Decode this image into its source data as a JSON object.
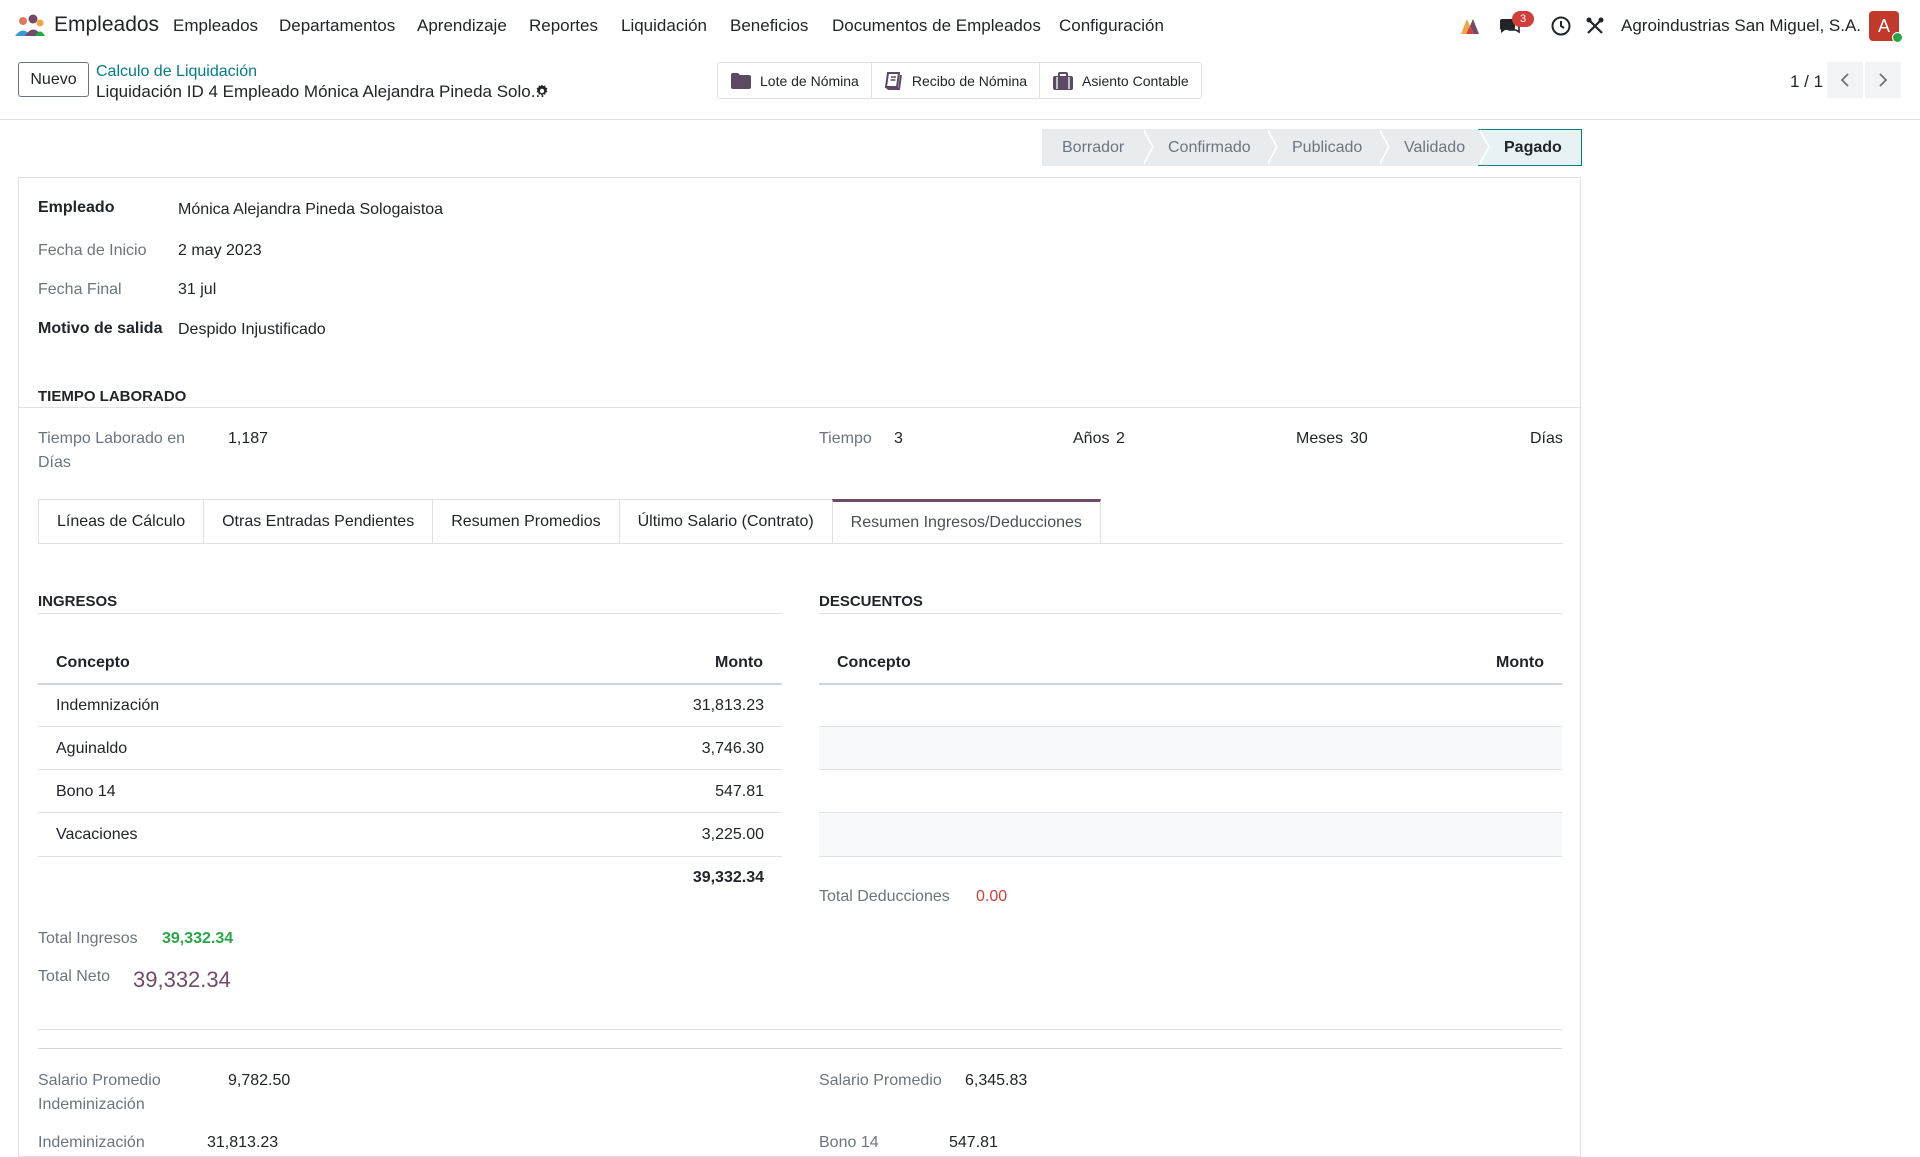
{
  "app": {
    "name": "Empleados",
    "menu": [
      "Empleados",
      "Departamentos",
      "Aprendizaje",
      "Reportes",
      "Liquidación",
      "Beneficios",
      "Documentos de Empleados",
      "Configuración"
    ],
    "notification_count": "3",
    "company": "Agroindustrias San Miguel, S.A.",
    "avatar_initial": "A"
  },
  "control_panel": {
    "new_button": "Nuevo",
    "breadcrumb_parent": "Calculo de Liquidación",
    "breadcrumb_current": "Liquidación ID 4 Empleado Mónica Alejandra Pineda Solo...",
    "smart_buttons": [
      "Lote de Nómina",
      "Recibo de Nómina",
      "Asiento Contable"
    ],
    "pager": "1 / 1"
  },
  "statusbar": [
    "Borrador",
    "Confirmado",
    "Publicado",
    "Validado",
    "Pagado"
  ],
  "statusbar_active": "Pagado",
  "header_fields": {
    "empleado_label": "Empleado",
    "empleado_value": "Mónica Alejandra Pineda Sologaistoa",
    "fecha_inicio_label": "Fecha de Inicio",
    "fecha_inicio_value": "2 may 2023",
    "fecha_final_label": "Fecha Final",
    "fecha_final_value": "31 jul",
    "motivo_label": "Motivo de salida",
    "motivo_value": "Despido Injustificado"
  },
  "tiempo": {
    "title": "TIEMPO LABORADO",
    "dias_label_1": "Tiempo Laborado en",
    "dias_label_2": "Días",
    "dias_value": "1,187",
    "tiempo_label": "Tiempo",
    "anos_value": "3",
    "anos_label": "Años",
    "meses_value": "2",
    "meses_label": "Meses",
    "dias_count": "30",
    "dias_unit": "Días"
  },
  "tabs": [
    "Líneas de Cálculo",
    "Otras Entradas Pendientes",
    "Resumen Promedios",
    "Último Salario (Contrato)",
    "Resumen Ingresos/Deducciones"
  ],
  "tabs_active": "Resumen Ingresos/Deducciones",
  "ingresos": {
    "title": "INGRESOS",
    "col_concepto": "Concepto",
    "col_monto": "Monto",
    "rows": [
      {
        "concepto": "Indemnización",
        "monto": "31,813.23"
      },
      {
        "concepto": "Aguinaldo",
        "monto": "3,746.30"
      },
      {
        "concepto": "Bono 14",
        "monto": "547.81"
      },
      {
        "concepto": "Vacaciones",
        "monto": "3,225.00"
      }
    ],
    "subtotal": "39,332.34",
    "total_label": "Total Ingresos",
    "total_value": "39,332.34",
    "neto_label": "Total Neto",
    "neto_value": "39,332.34"
  },
  "descuentos": {
    "title": "DESCUENTOS",
    "col_concepto": "Concepto",
    "col_monto": "Monto",
    "total_label": "Total Deducciones",
    "total_value": "0.00"
  },
  "promedios": {
    "left_label_1": "Salario Promedio",
    "left_label_2": "Indeminización",
    "left_value": "9,782.50",
    "left_cut_label": "Indeminización",
    "left_cut_value": "31,813.23",
    "right_label": "Salario Promedio",
    "right_value": "6,345.83",
    "right_cut_label": "Bono 14",
    "right_cut_value": "547.81"
  },
  "colors": {
    "brand": "#714b67",
    "link": "#017e84",
    "positive": "#28a745",
    "negative": "#d23f3a"
  }
}
